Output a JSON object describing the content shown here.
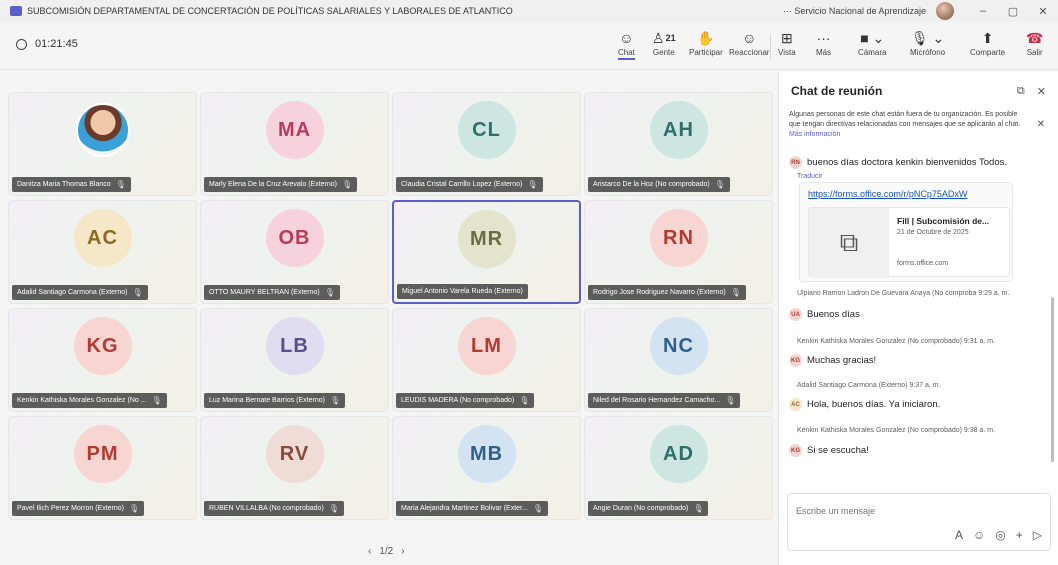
{
  "window": {
    "title": "SUBCOMISIÓN DEPARTAMENTAL DE CONCERTACIÓN DE POLÍTICAS SALARIALES Y LABORALES DE ATLANTICO",
    "org": "··· Servicio Nacional de Aprendizaje",
    "controls": [
      "–",
      "▢",
      "✕"
    ]
  },
  "toolbar": {
    "timer": "01:21:45",
    "people_count": "21",
    "buttons": {
      "chat": "Chat",
      "gente": "Gente",
      "participar": "Participar",
      "reaccionar": "Reaccionar",
      "vista": "Vista",
      "mas": "Más",
      "camara": "Cámara",
      "microfono": "Micrófono",
      "comparte": "Comparte",
      "salir": "Salir"
    }
  },
  "participants": [
    {
      "initials": "",
      "name": "Danitza Maria Thomas Blanco",
      "photo": true,
      "color": "#000000",
      "bg": "#000000"
    },
    {
      "initials": "MA",
      "name": "Marly Elena De la Cruz Arevalo (Externo)",
      "color": "#b83b5a",
      "bg": "#f6d3dc"
    },
    {
      "initials": "CL",
      "name": "Claudia Cristal Carrillo Lopez (Externo)",
      "color": "#2f6f6a",
      "bg": "#cde6e2"
    },
    {
      "initials": "AH",
      "name": "Aristarco De la Hoz (No comprobado)",
      "color": "#2f6f6a",
      "bg": "#cde6e2"
    },
    {
      "initials": "AC",
      "name": "Adalid Santiago Carmona (Externo)",
      "color": "#8a6a1c",
      "bg": "#f5e7c8"
    },
    {
      "initials": "OB",
      "name": "OTTO MAURY BELTRAN (Externo)",
      "color": "#b83b5a",
      "bg": "#f6d3dc"
    },
    {
      "initials": "MR",
      "name": "Miguel Antonio Varela Rueda (Externo)",
      "color": "#6b6b47",
      "bg": "#e4e4cc",
      "active": true
    },
    {
      "initials": "RN",
      "name": "Rodrigo Jose Rodriguez Navarro (Externo)",
      "color": "#b33a2f",
      "bg": "#f6d5d3"
    },
    {
      "initials": "KG",
      "name": "Kenkin Kathiska Morales Gonzalez (No ...",
      "color": "#b33a2f",
      "bg": "#f6d5d3"
    },
    {
      "initials": "LB",
      "name": "Luz Marina Bernate Barrios (Externo)",
      "color": "#5a4f8a",
      "bg": "#e1dcf0"
    },
    {
      "initials": "LM",
      "name": "LEUDIS MADERA (No comprobado)",
      "color": "#b33a2f",
      "bg": "#f6d5d3"
    },
    {
      "initials": "NC",
      "name": "Niled del Rosario Hernandez Camacho...",
      "color": "#2f5f8a",
      "bg": "#d3e3f2"
    },
    {
      "initials": "PM",
      "name": "Pavel Ilich Perez Morron (Externo)",
      "color": "#b33a2f",
      "bg": "#f6d5d3"
    },
    {
      "initials": "RV",
      "name": "RUBEN VILLALBA (No comprobado)",
      "color": "#8a4a3a",
      "bg": "#f0dcd6"
    },
    {
      "initials": "MB",
      "name": "Maria Alejandra Martinez Bolivar (Exter...",
      "color": "#2f5f8a",
      "bg": "#d3e3f2"
    },
    {
      "initials": "AD",
      "name": "Angie Duran (No comprobado)",
      "color": "#2f6f6a",
      "bg": "#cde6e2"
    }
  ],
  "pager": {
    "prev": "‹",
    "label": "1/2",
    "next": "›"
  },
  "chat": {
    "title": "Chat de reunión",
    "notice_text": "Algunas personas de este chat están fuera de tu organización. Es posible que tengan directivas relacionadas con mensajes que se aplicarán al chat.",
    "notice_link": "Más información",
    "msg_rn_avatar": "RN",
    "msg_rn_text": "buenos días doctora kenkin bienvenidos Todos.",
    "translate": "Traducir",
    "card_url": "https://forms.office.com/r/pNCp75ADxW",
    "card_title": "Fill | Subcomisión de...",
    "card_date": "21 de Octubre de 2025",
    "card_domain": "forms.office.com",
    "msg1_meta": "Ulpiano Ramon Ladron De Guevara Anaya (No comproba  9:29 a. m.",
    "msg1_avatar": "UA",
    "msg1_text": "Buenos días",
    "msg2_meta": "Kenkin Kathiska Morales Gonzalez (No comprobado)  9:31 a. m.",
    "msg2_avatar": "KG",
    "msg2_text": "Muchas gracias!",
    "msg3_meta": "Adalid Santiago Carmona (Externo)  9:37 a. m.",
    "msg3_avatar": "AC",
    "msg3_text": "Hola, buenos días. Ya iniciaron.",
    "msg4_meta": "Kenkin Kathiska Morales Gonzalez (No comprobado)  9:38 a. m.",
    "msg4_avatar": "KG",
    "msg4_text": "Si se escucha!",
    "compose_placeholder": "Escribe un mensaje"
  },
  "colors": {
    "accent": "#5b5fc7",
    "leave": "#c4314b"
  }
}
